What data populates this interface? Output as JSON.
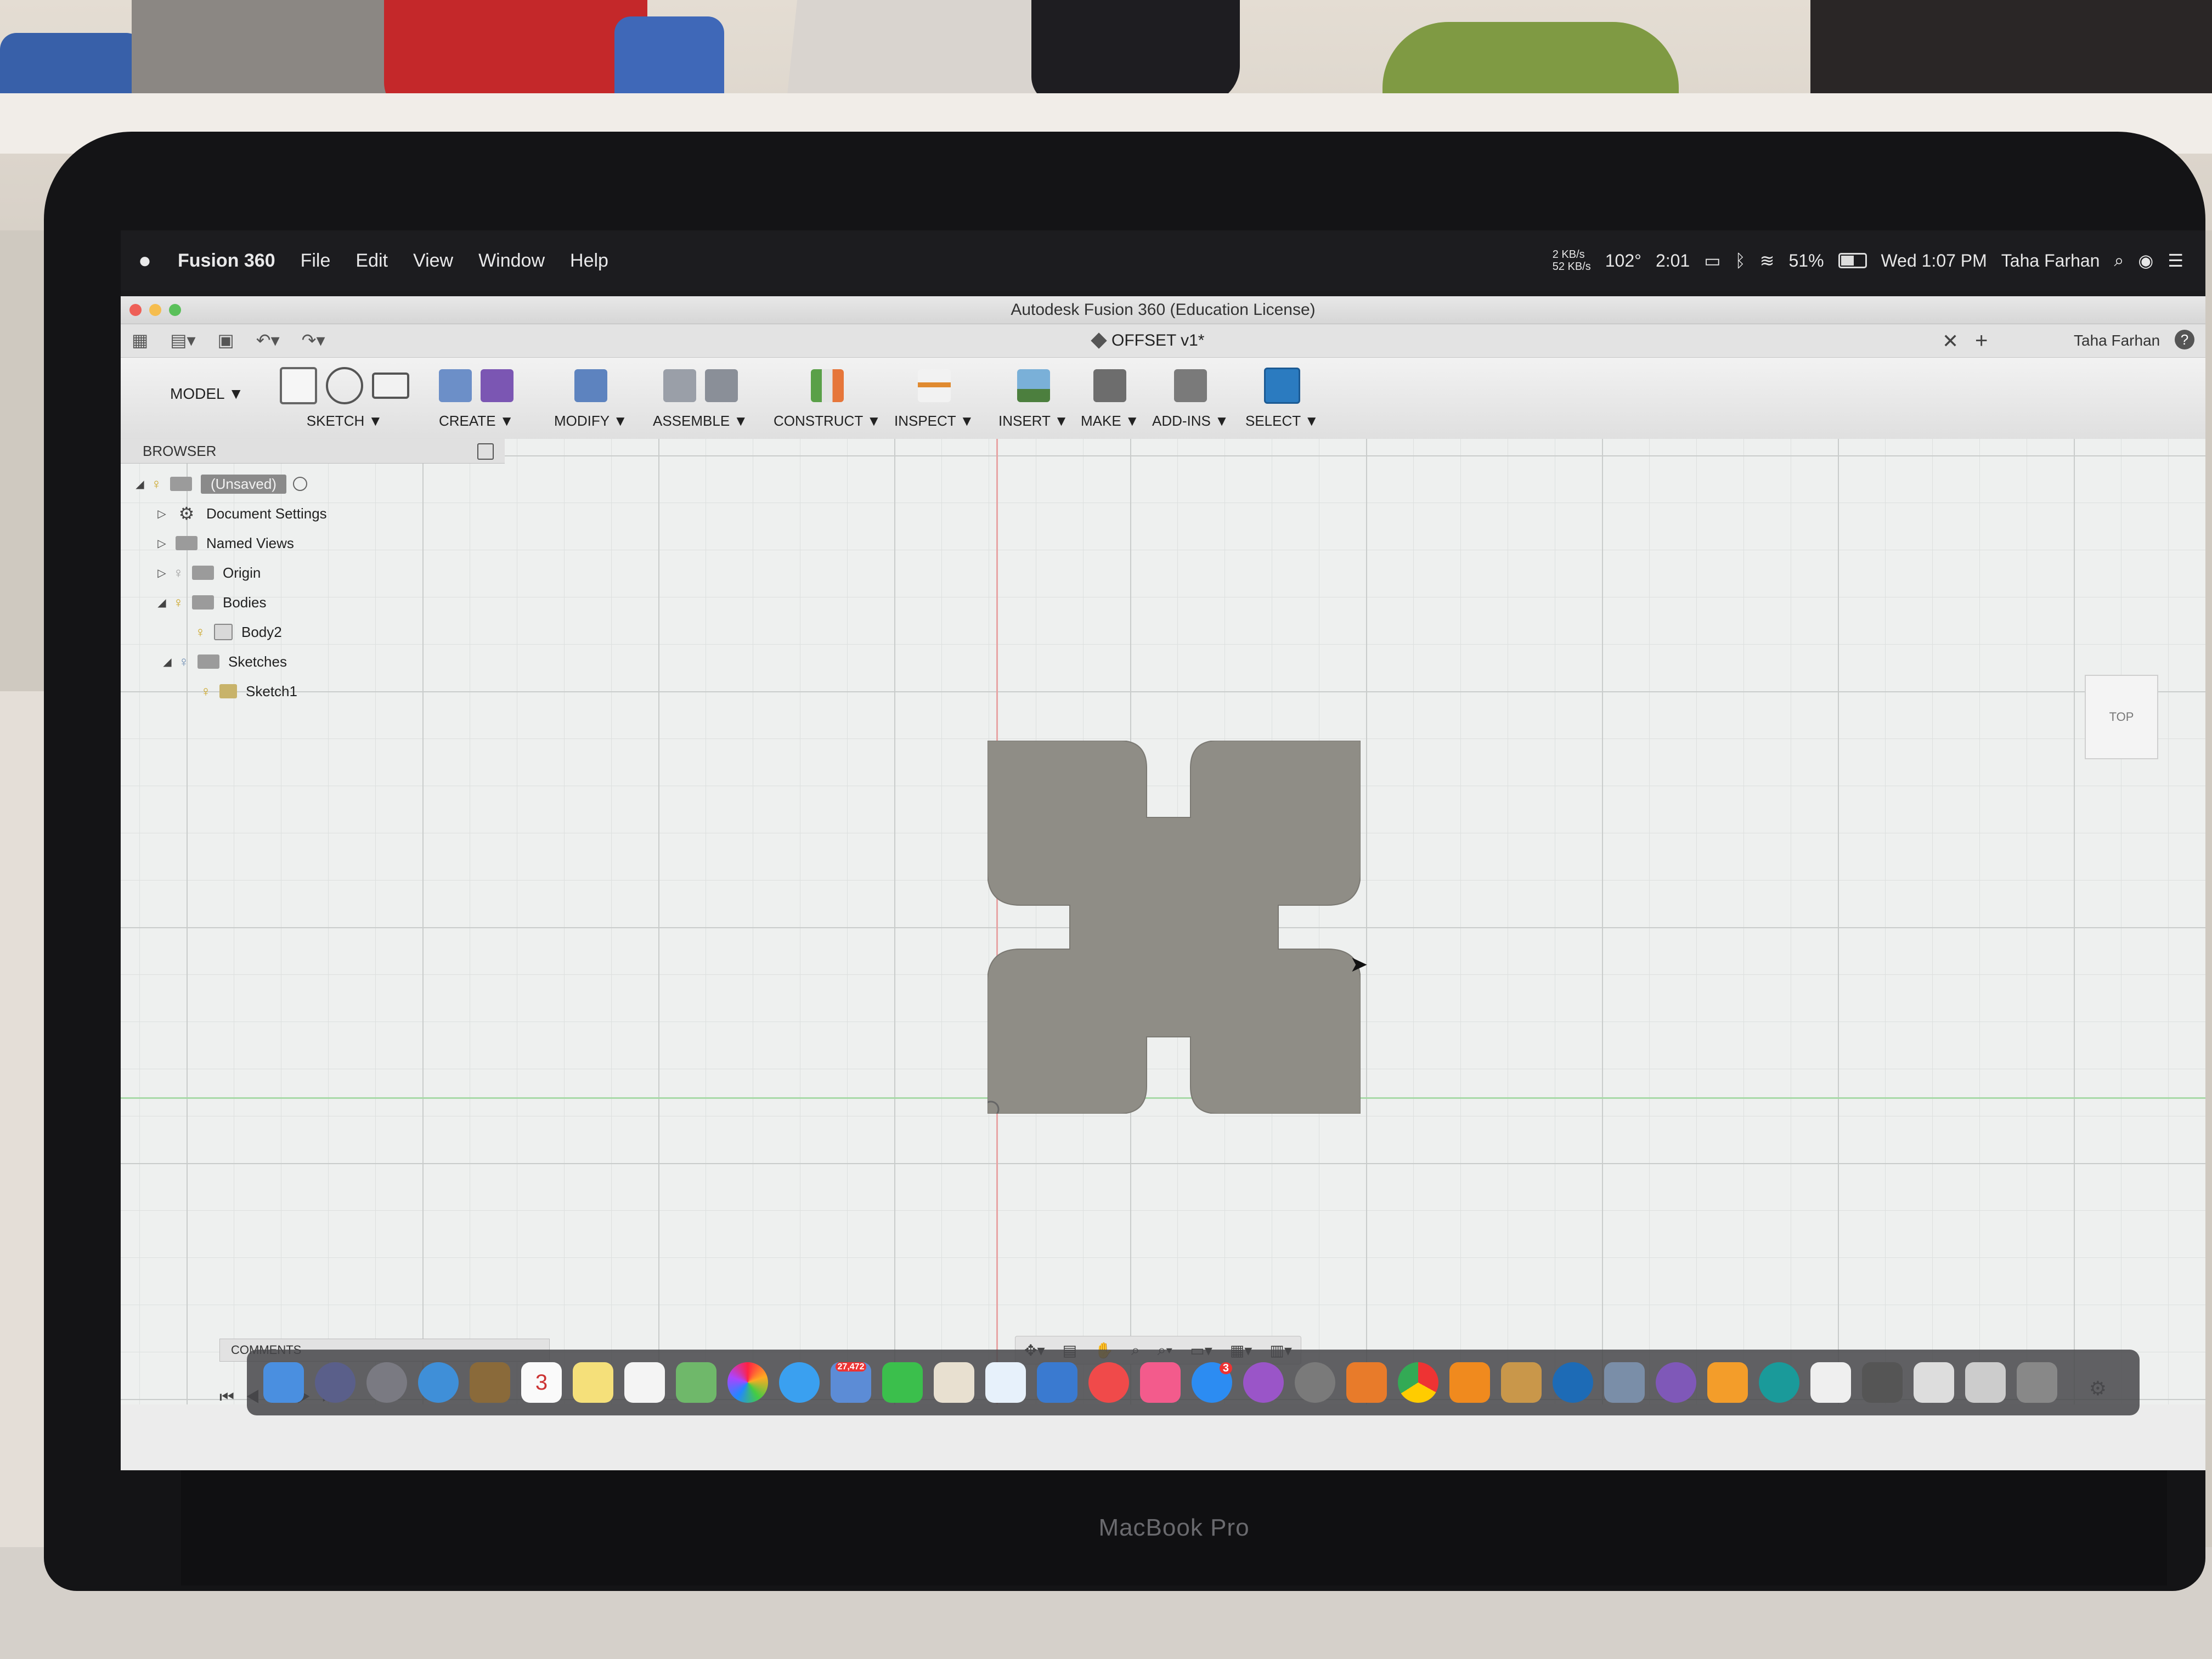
{
  "menubar": {
    "app_name": "Fusion 360",
    "menus": [
      "File",
      "Edit",
      "View",
      "Window",
      "Help"
    ],
    "net_up": "2 KB/s",
    "net_down": "52 KB/s",
    "temperature": "102°",
    "battery_time": "2:01",
    "battery_percent": "51%",
    "clock": "Wed 1:07 PM",
    "user": "Taha Farhan"
  },
  "window": {
    "title": "Autodesk Fusion 360 (Education License)",
    "document_tab": "OFFSET v1*",
    "user": "Taha Farhan",
    "help": "?"
  },
  "toolbar": {
    "workspace": "MODEL ▼",
    "groups": {
      "sketch": "SKETCH ▼",
      "create": "CREATE ▼",
      "modify": "MODIFY ▼",
      "assemble": "ASSEMBLE ▼",
      "construct": "CONSTRUCT ▼",
      "inspect": "INSPECT ▼",
      "insert": "INSERT ▼",
      "make": "MAKE ▼",
      "addins": "ADD-INS ▼",
      "select": "SELECT ▼"
    }
  },
  "browser": {
    "title": "BROWSER",
    "items": {
      "root": "(Unsaved)",
      "doc_settings": "Document Settings",
      "named_views": "Named Views",
      "origin": "Origin",
      "bodies": "Bodies",
      "body2": "Body2",
      "sketches": "Sketches",
      "sketch1": "Sketch1"
    }
  },
  "viewcube": {
    "label": "TOP"
  },
  "comments": {
    "label": "COMMENTS"
  },
  "device_label": "MacBook Pro",
  "dock_badges": {
    "calendar_day": "3",
    "mail_count": "27,472",
    "appstore": "3"
  },
  "colors": {
    "shape_fill": "#8f8d86",
    "select_blue": "#2b7bc0",
    "bulb": "#c9a11c"
  },
  "icons": [
    "apple-icon",
    "search-icon",
    "wifi-icon",
    "bluetooth-icon",
    "battery-icon",
    "gear-icon",
    "lightbulb-icon",
    "folder-icon",
    "close-icon",
    "plus-icon",
    "help-icon"
  ]
}
